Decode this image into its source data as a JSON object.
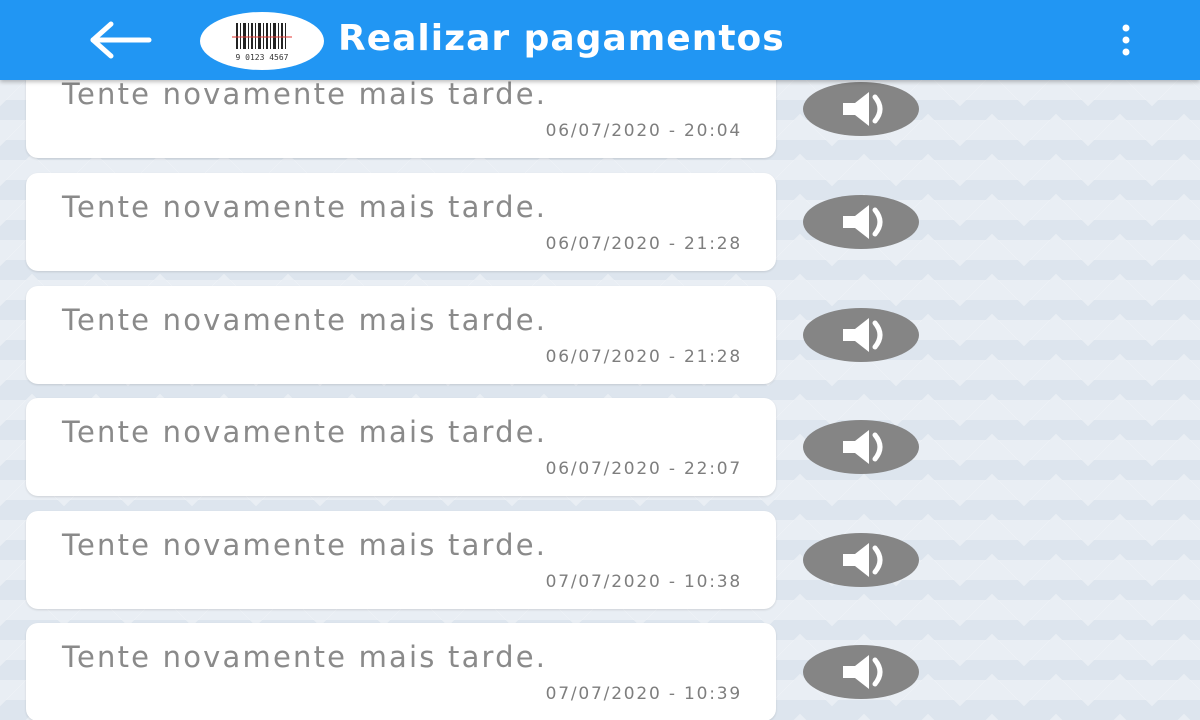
{
  "app_bar": {
    "title": "Realizar pagamentos",
    "back_icon": "arrow-left-icon",
    "avatar_icon": "barcode-icon",
    "avatar_digits": "9 0123 4567",
    "menu_icon": "more-vertical-icon",
    "color": "#2196f3"
  },
  "messages": [
    {
      "text": "Tente novamente mais tarde.",
      "timestamp": "06/07/2020 - 20:04",
      "action_icon": "speaker-icon"
    },
    {
      "text": "Tente novamente mais tarde.",
      "timestamp": "06/07/2020 - 21:28",
      "action_icon": "speaker-icon"
    },
    {
      "text": "Tente novamente mais tarde.",
      "timestamp": "06/07/2020 - 21:28",
      "action_icon": "speaker-icon"
    },
    {
      "text": "Tente novamente mais tarde.",
      "timestamp": "06/07/2020 - 22:07",
      "action_icon": "speaker-icon"
    },
    {
      "text": "Tente novamente mais tarde.",
      "timestamp": "07/07/2020 - 10:38",
      "action_icon": "speaker-icon"
    },
    {
      "text": "Tente novamente mais tarde.",
      "timestamp": "07/07/2020 - 10:39",
      "action_icon": "speaker-icon"
    }
  ]
}
